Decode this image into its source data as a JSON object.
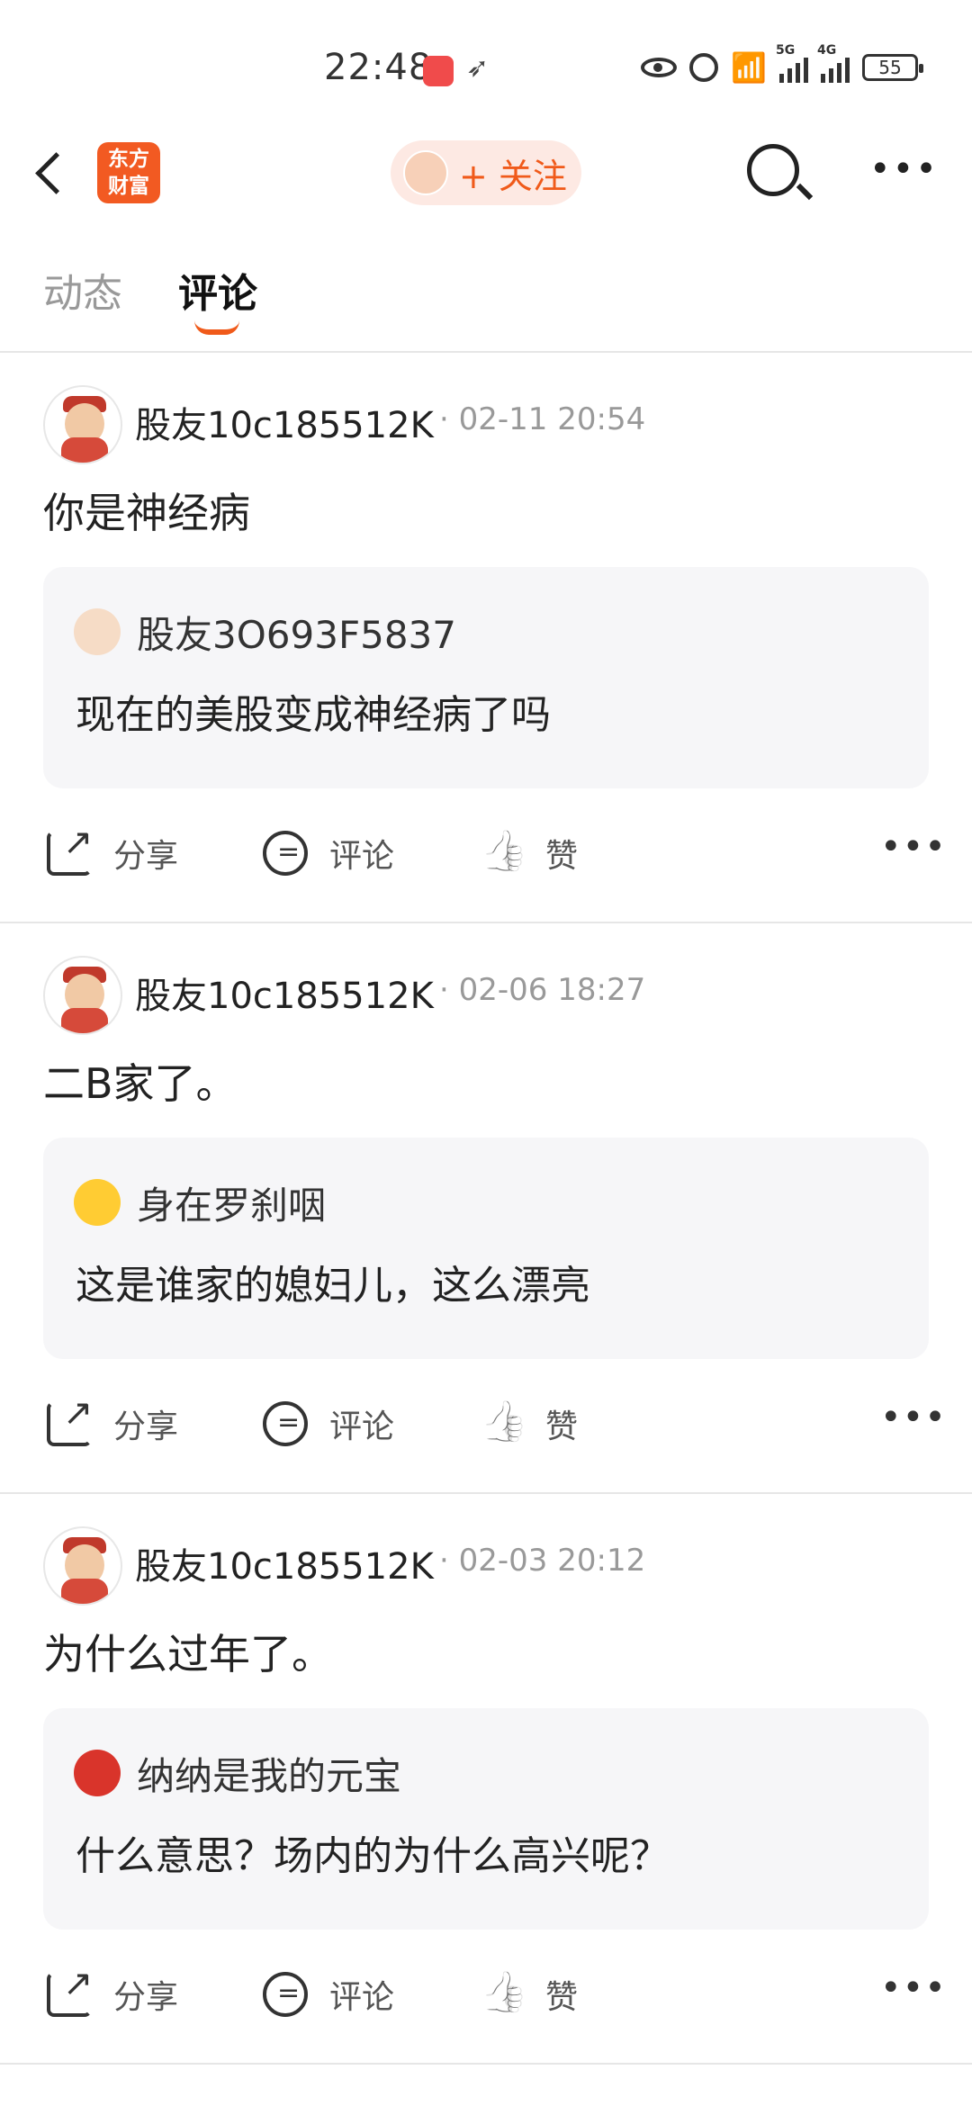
{
  "status_bar": {
    "time": "22:48",
    "signal_label": "5G",
    "signal_label2": "4G",
    "battery": "55"
  },
  "nav": {
    "logo_text_line1": "东方",
    "logo_text_line2": "财富",
    "follow_label": "+ 关注"
  },
  "tabs": [
    {
      "label": "动态"
    },
    {
      "label": "评论"
    }
  ],
  "posts": [
    {
      "author": "股友10c185512K",
      "time": "· 02-11 20:54",
      "text": "你是神经病",
      "quote_author": "股友3O693F5837",
      "quote_text": "现在的美股变成神经病了吗",
      "share": "分享",
      "comment": "评论",
      "like": "赞"
    },
    {
      "author": "股友10c185512K",
      "time": "· 02-06 18:27",
      "text": "二B家了。",
      "quote_author": "身在罗刹咽",
      "quote_text": "这是谁家的媳妇儿，这么漂亮",
      "share": "分享",
      "comment": "评论",
      "like": "赞"
    },
    {
      "author": "股友10c185512K",
      "time": "· 02-03 20:12",
      "text": "为什么过年了。",
      "quote_author": "纳纳是我的元宝",
      "quote_text": "什么意思？场内的为什么高兴呢？",
      "share": "分享",
      "comment": "评论",
      "like": "赞"
    }
  ]
}
